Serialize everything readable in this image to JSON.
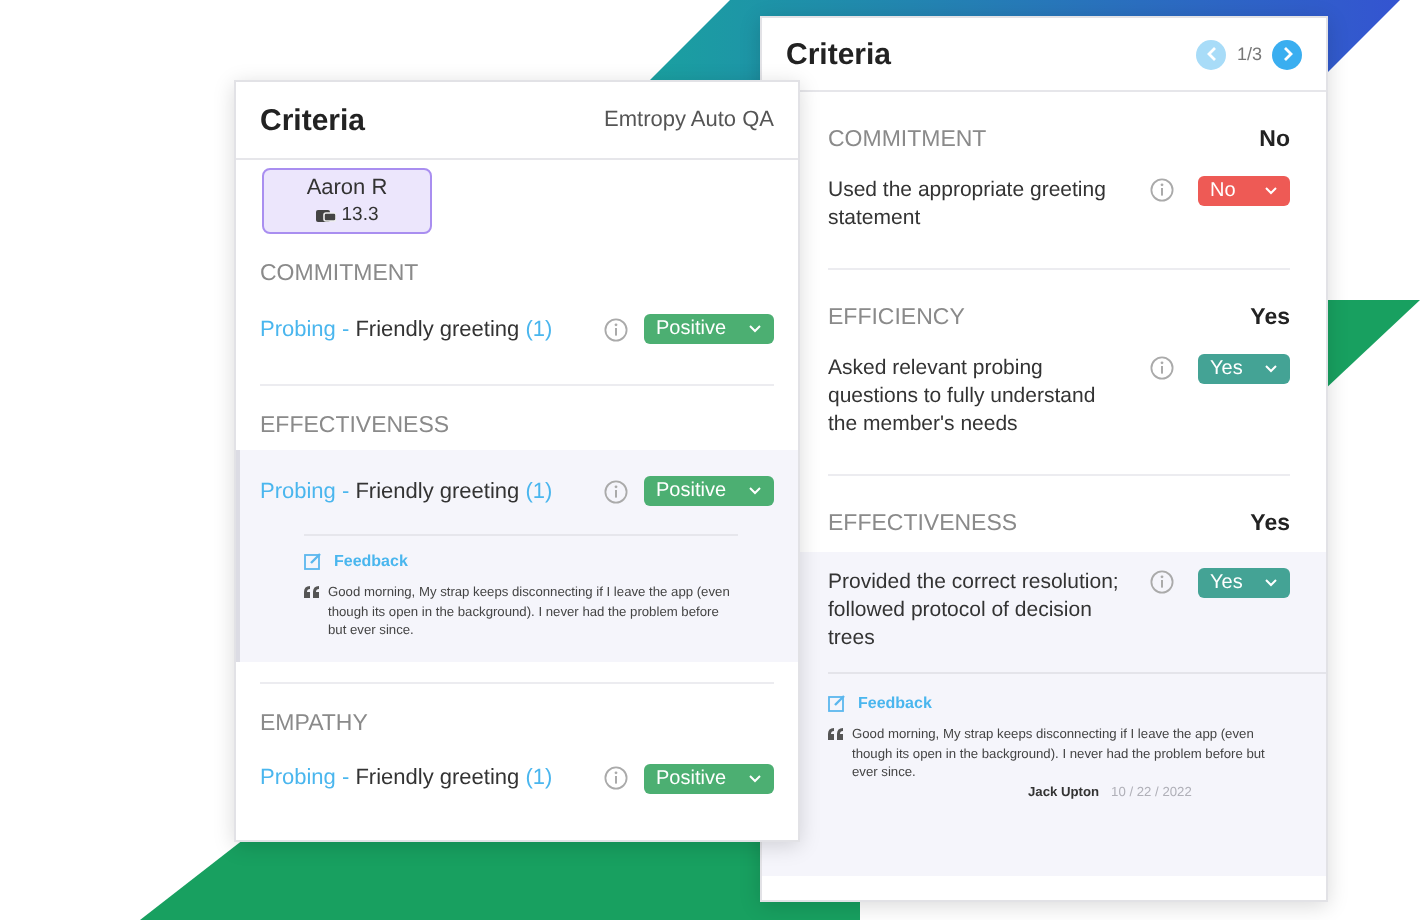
{
  "left_panel": {
    "title": "Criteria",
    "subtitle": "Emtropy Auto QA",
    "agent": {
      "name": "Aaron R",
      "score": "13.3"
    },
    "sections": [
      {
        "heading": "COMMITMENT",
        "items": [
          {
            "tag": "Probing -",
            "label": "Friendly greeting",
            "count": "(1)",
            "rating": {
              "value": "Positive",
              "color": "#4caf72"
            },
            "expanded": false
          }
        ]
      },
      {
        "heading": "EFFECTIVENESS",
        "items": [
          {
            "tag": "Probing -",
            "label": "Friendly greeting",
            "count": "(1)",
            "rating": {
              "value": "Positive",
              "color": "#4caf72"
            },
            "expanded": true,
            "feedback": {
              "title": "Feedback",
              "quote": "Good morning, My strap keeps disconnecting if I leave the app (even though its open in the background). I never had the problem before but ever since."
            }
          }
        ]
      },
      {
        "heading": "EMPATHY",
        "items": [
          {
            "tag": "Probing -",
            "label": "Friendly greeting",
            "count": "(1)",
            "rating": {
              "value": "Positive",
              "color": "#4caf72"
            },
            "expanded": false
          }
        ]
      }
    ]
  },
  "right_panel": {
    "title": "Criteria",
    "pager": {
      "text": "1/3",
      "prev_disabled": true,
      "next_disabled": false
    },
    "sections": [
      {
        "heading": "COMMITMENT",
        "result": "No",
        "items": [
          {
            "text": "Used the appropriate greeting statement",
            "rating": {
              "value": "No",
              "color": "#ee5a55"
            },
            "expanded": false
          }
        ]
      },
      {
        "heading": "EFFICIENCY",
        "result": "Yes",
        "items": [
          {
            "text": "Asked relevant probing questions to fully understand the member's needs",
            "rating": {
              "value": "Yes",
              "color": "#44a395"
            },
            "expanded": false
          }
        ]
      },
      {
        "heading": "EFFECTIVENESS",
        "result": "Yes",
        "items": [
          {
            "text": "Provided the correct resolution; followed protocol of decision trees",
            "rating": {
              "value": "Yes",
              "color": "#44a395"
            },
            "expanded": true,
            "feedback": {
              "title": "Feedback",
              "quote": "Good morning, My strap keeps disconnecting if I leave the app (even though its open in the background). I never had the problem before but ever since.",
              "author": "Jack Upton",
              "date": "10 / 22 / 2022"
            }
          }
        ]
      }
    ]
  }
}
